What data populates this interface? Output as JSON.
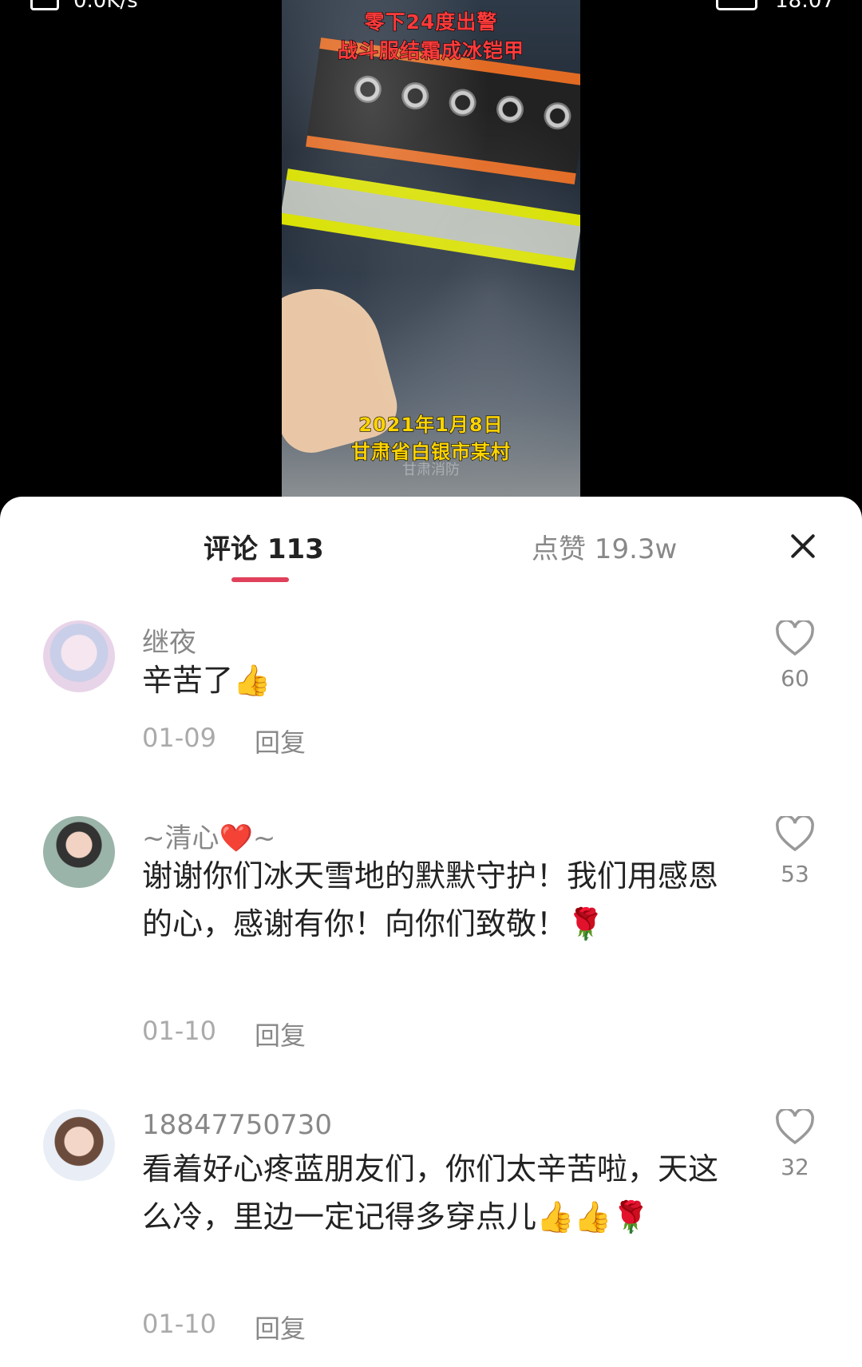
{
  "status_bar": {
    "speed": "0.0K/s",
    "time": "18:07"
  },
  "video": {
    "caption_top_line1": "零下24度出警",
    "caption_top_line2": "战斗服结霜成冰铠甲",
    "caption_bottom_line1": "2021年1月8日",
    "caption_bottom_line2": "甘肃省白银市某村",
    "watermark": "甘肃消防"
  },
  "panel": {
    "tab_comments": "评论 113",
    "tab_likes": "点赞 19.3w",
    "accent_color": "#e0405c"
  },
  "comments": [
    {
      "username": "继夜",
      "text": "辛苦了👍",
      "date": "01-09",
      "reply": "回复",
      "likes": "60"
    },
    {
      "username": "~清心❤️~",
      "text": "谢谢你们冰天雪地的默默守护！我们用感恩的心，感谢有你！向你们致敬！🌹",
      "date": "01-10",
      "reply": "回复",
      "likes": "53"
    },
    {
      "username": "18847750730",
      "text": "看着好心疼蓝朋友们，你们太辛苦啦，天这么冷，里边一定记得多穿点儿👍👍🌹",
      "date": "01-10",
      "reply": "回复",
      "likes": "32"
    }
  ]
}
